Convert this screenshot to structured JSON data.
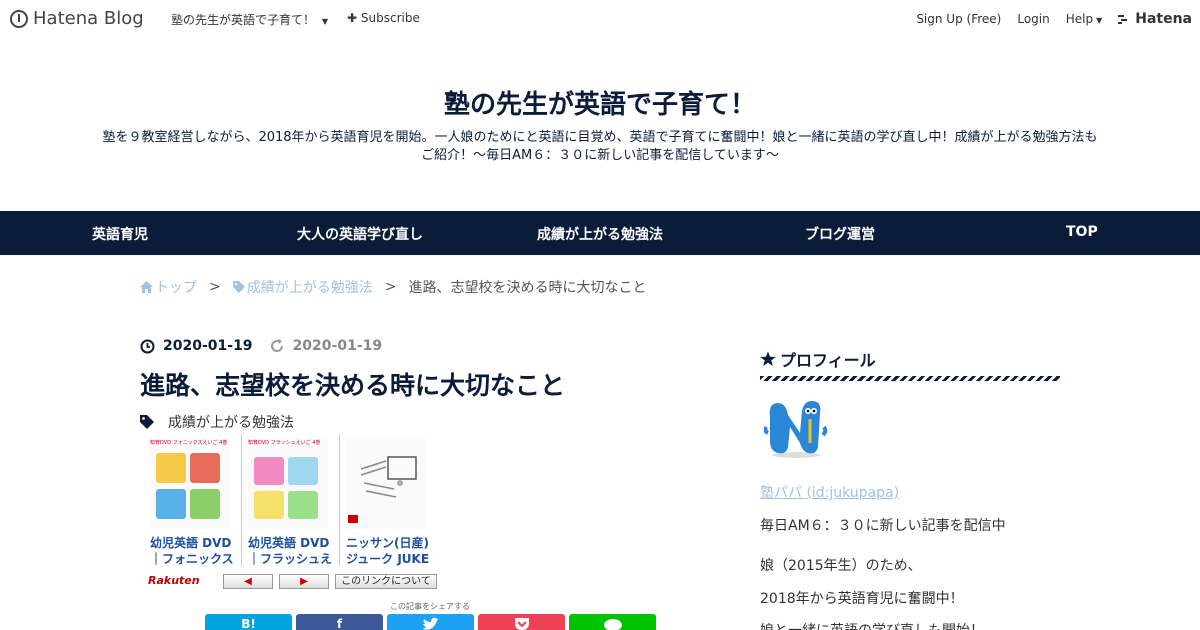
{
  "topbar": {
    "brand": "Hatena Blog",
    "blog_selector": "塾の先生が英語で子育て！",
    "subscribe": "Subscribe",
    "signup": "Sign Up (Free)",
    "login": "Login",
    "help": "Help",
    "hatena": "Hatena"
  },
  "blog": {
    "title": "塾の先生が英語で子育て！",
    "description": "塾を９教室経営しながら、2018年から英語育児を開始。一人娘のためにと英語に目覚め、英語で子育てに奮闘中！娘と一緒に英語の学び直し中！成績が上がる勉強方法もご紹介！～毎日AM６：３０に新しい記事を配信しています～"
  },
  "nav": {
    "items": [
      "英語育児",
      "大人の英語学び直し",
      "成績が上がる勉強法",
      "ブログ運営",
      "TOP"
    ]
  },
  "breadcrumb": {
    "top": "トップ",
    "category": "成績が上がる勉強法",
    "current": "進路、志望校を決める時に大切なこと",
    "separator": ">"
  },
  "article": {
    "published": "2020-01-19",
    "updated": "2020-01-19",
    "title": "進路、志望校を決める時に大切なこと",
    "category": "成績が上がる勉強法"
  },
  "widget": {
    "products": [
      {
        "line1": "幼児英語 DVD",
        "line2": "｜フォニックス",
        "badge": "知育DVD フォニックスえいご 4巻"
      },
      {
        "line1": "幼児英語 DVD",
        "line2": "｜フラッシュえ",
        "badge": "知育DVD フラッシュえいご 4巻"
      },
      {
        "line1": "ニッサン(日産)",
        "line2": "ジューク JUKE",
        "badge": ""
      }
    ],
    "rakuten": "Rakuten",
    "prev": "◀",
    "next": "▶",
    "about_link": "このリンクについて"
  },
  "share": {
    "caption": "この記事をシェアする",
    "hatena_label": "B!",
    "facebook_label": "f",
    "colors": {
      "hatena": "#00a4de",
      "facebook": "#3b5998",
      "twitter": "#1da1f2",
      "pocket": "#ef4056",
      "line": "#00c300"
    }
  },
  "sidebar": {
    "heading": "プロフィール",
    "profile_link": "塾パパ (id:jukupapa)",
    "lines": [
      "毎日AM６：３０に新しい記事を配信中",
      "娘（2015年生）のため、",
      "2018年から英語育児に奮闘中！",
      "娘と一緒に英語の学び直しも開始！"
    ]
  },
  "colors": {
    "navy": "#0b1c3b",
    "link_light": "#9ec3e0",
    "product_link": "#1d4fa0"
  }
}
